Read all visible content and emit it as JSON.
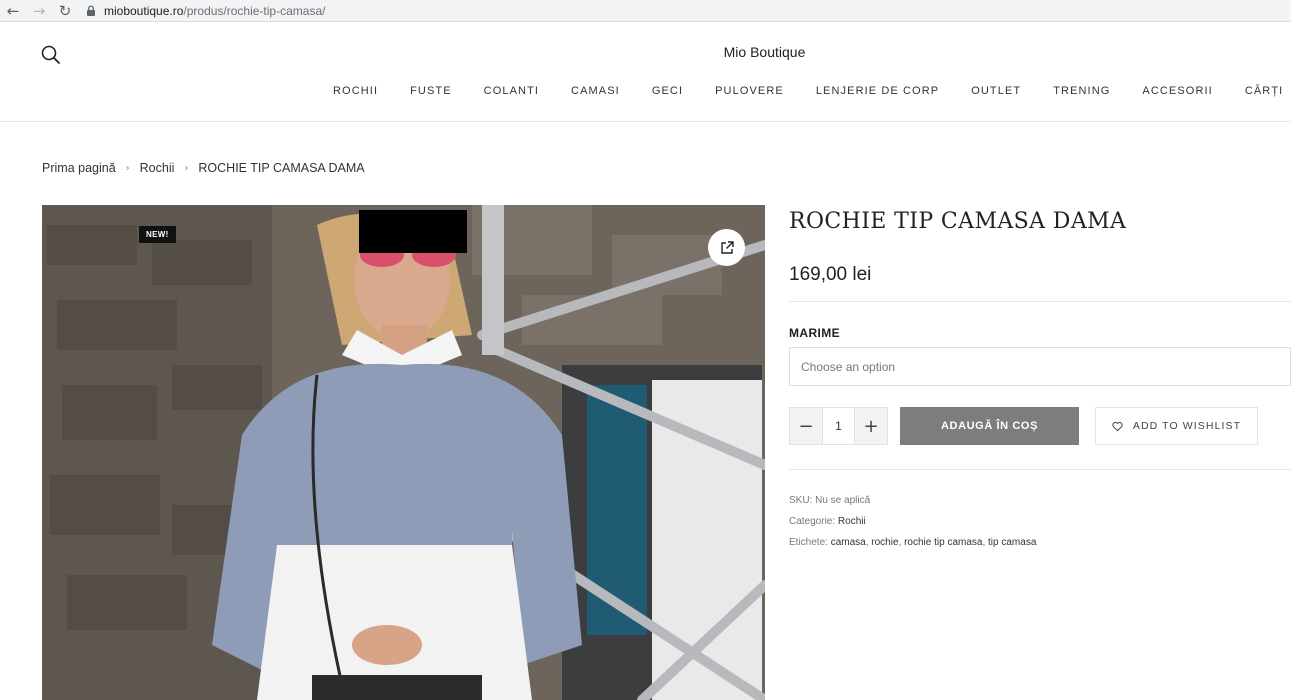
{
  "browser": {
    "url_host": "mioboutique.ro",
    "url_path": "/produs/rochie-tip-camasa/"
  },
  "header": {
    "site_title": "Mio Boutique",
    "nav": [
      "ROCHII",
      "FUSTE",
      "COLANTI",
      "CAMASI",
      "GECI",
      "PULOVERE",
      "LENJERIE DE CORP",
      "OUTLET",
      "TRENING",
      "ACCESORII",
      "CĂRȚI"
    ]
  },
  "breadcrumb": [
    "Prima pagină",
    "Rochii",
    "ROCHIE TIP CAMASA DAMA"
  ],
  "product": {
    "badge": "NEW!",
    "title": "ROCHIE TIP CAMASA DAMA",
    "price": "169,00 lei",
    "attribute_label": "MARIME",
    "select_placeholder": "Choose an option",
    "quantity": "1",
    "add_to_cart": "ADAUGĂ ÎN COȘ",
    "wishlist": "ADD TO WISHLIST",
    "meta": {
      "sku_label": "SKU:",
      "sku_value": "Nu se aplică",
      "category_label": "Categorie:",
      "category_value": "Rochii",
      "tags_label": "Etichete:",
      "tags": [
        "camasa",
        "rochie",
        "rochie tip camasa",
        "tip camasa"
      ]
    }
  },
  "colors": {
    "add_to_cart_bg": "#7d7d7d",
    "badge_bg": "#111111"
  }
}
